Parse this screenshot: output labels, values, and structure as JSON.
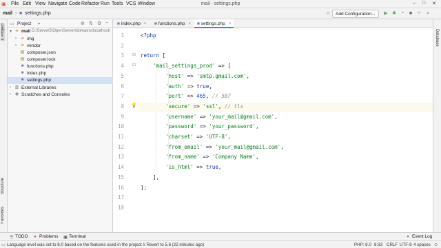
{
  "menu": [
    "File",
    "Edit",
    "View",
    "Navigate",
    "Code",
    "Refactor",
    "Run",
    "Tools",
    "VCS",
    "Window"
  ],
  "window_title": "mail - settings.php",
  "breadcrumbs": [
    "mail",
    "settings.php"
  ],
  "toolbar": {
    "run_config_label": "Add Configuration..."
  },
  "left_strip": {
    "project": "1: Project",
    "structure": "Structure",
    "favorites": "Favorites"
  },
  "right_strip": {
    "database": "Database"
  },
  "project_panel": {
    "title": "Project",
    "tree": [
      {
        "label": "mail",
        "path": "D:\\Server5\\OpenServer\\domains\\localhost\\",
        "kind": "folder",
        "depth": 0,
        "expanded": true
      },
      {
        "label": "img",
        "kind": "folder",
        "depth": 1,
        "expanded": false
      },
      {
        "label": "vendor",
        "kind": "folder",
        "depth": 1,
        "expanded": false
      },
      {
        "label": "composer.json",
        "kind": "json",
        "depth": 1
      },
      {
        "label": "composer.lock",
        "kind": "json",
        "depth": 1
      },
      {
        "label": "functions.php",
        "kind": "php",
        "depth": 1
      },
      {
        "label": "index.php",
        "kind": "php",
        "depth": 1
      },
      {
        "label": "settings.php",
        "kind": "php",
        "depth": 1,
        "selected": true
      },
      {
        "label": "External Libraries",
        "kind": "lib",
        "depth": 0,
        "expanded": false
      },
      {
        "label": "Scratches and Consoles",
        "kind": "scratch",
        "depth": 0,
        "expanded": false
      }
    ]
  },
  "editor_tabs": [
    {
      "label": "index.php",
      "active": false
    },
    {
      "label": "functions.php",
      "active": false
    },
    {
      "label": "settings.php",
      "active": true
    }
  ],
  "code": {
    "current_line": 8,
    "lines": [
      "<?php",
      "",
      "return [",
      "    'mail_settings_prod' => [",
      "        'host' => 'smtp.gmail.com',",
      "        'auth' => true,",
      "        'port' => 465, // 587",
      "        'secure' => 'ssl', // tls",
      "        'username' => 'your_mail@gmail.com',",
      "        'password' => 'your_password',",
      "        'charset' => 'UTF-8',",
      "        'from_email' => 'your_mail@gmail.com',",
      "        'from_name' => 'Company Name',",
      "        'is_html' => true,",
      "    ],",
      "];",
      "",
      ""
    ]
  },
  "bottom_tabs": [
    "TODO",
    "Problems",
    "Terminal"
  ],
  "event_log": "Event Log",
  "status": {
    "message": "Language level was set to 8.0 based on the features used in the project // Revert to 5.6 (22 minutes ago)",
    "php_version": "PHP: 8.0",
    "position": "8:33",
    "line_ending": "CRLF",
    "encoding": "UTF-8",
    "indent": "4 spaces"
  },
  "colors": {
    "keyword": "#0033b3",
    "string": "#067d17",
    "number": "#1750eb",
    "comment": "#8c8c8c",
    "accent": "#4a7ec7"
  }
}
